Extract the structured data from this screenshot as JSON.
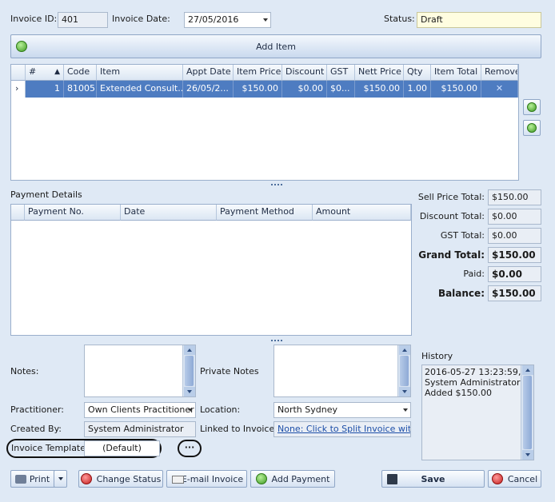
{
  "header": {
    "invoice_id_label": "Invoice ID:",
    "invoice_id": "401",
    "invoice_date_label": "Invoice Date:",
    "invoice_date": "27/05/2016",
    "status_label": "Status:",
    "status": "Draft"
  },
  "add_item_label": "Add Item",
  "items_grid": {
    "columns": [
      "#",
      "Code",
      "Item",
      "Appt Date",
      "Item Price",
      "Discount",
      "GST",
      "Nett Price",
      "Qty",
      "Item Total",
      "Remove"
    ],
    "rows": [
      {
        "num": "1",
        "code": "81005",
        "item": "Extended Consult...",
        "appt_date": "26/05/2...",
        "item_price": "$150.00",
        "discount": "$0.00",
        "gst": "$0...",
        "nett_price": "$150.00",
        "qty": "1.00",
        "item_total": "$150.00",
        "remove": "✕"
      }
    ]
  },
  "payment": {
    "title": "Payment Details",
    "columns": [
      "Payment No.",
      "Date",
      "Payment Method",
      "Amount"
    ]
  },
  "totals": {
    "sell_price_label": "Sell Price Total:",
    "sell_price": "$150.00",
    "discount_label": "Discount Total:",
    "discount": "$0.00",
    "gst_label": "GST Total:",
    "gst": "$0.00",
    "grand_total_label": "Grand Total:",
    "grand_total": "$150.00",
    "paid_label": "Paid:",
    "paid": "$0.00",
    "balance_label": "Balance:",
    "balance": "$150.00"
  },
  "details": {
    "notes_label": "Notes:",
    "private_notes_label": "Private Notes",
    "practitioner_label": "Practitioner:",
    "practitioner": "Own Clients Practitioner",
    "location_label": "Location:",
    "location": "North Sydney",
    "created_by_label": "Created By:",
    "created_by": "System Administrator",
    "linked_label": "Linked to Invoice.",
    "linked_value": "None: Click to Split Invoice with ...",
    "template_label": "Invoice Template:",
    "template_value": "(Default)",
    "ellipsis": "···"
  },
  "history": {
    "title": "History",
    "text_lines": [
      "2016-05-27 13:23:59,",
      "System Administrator,",
      "Added $150.00"
    ]
  },
  "footer": {
    "print": "Print",
    "change_status": "Change Status",
    "email_invoice": "E-mail Invoice",
    "add_payment": "Add Payment",
    "save": "Save",
    "cancel": "Cancel"
  },
  "colors": {
    "selected_row": "#4e7cc1",
    "status_background": "#fffde0",
    "window_background": "#dfe9f5"
  }
}
